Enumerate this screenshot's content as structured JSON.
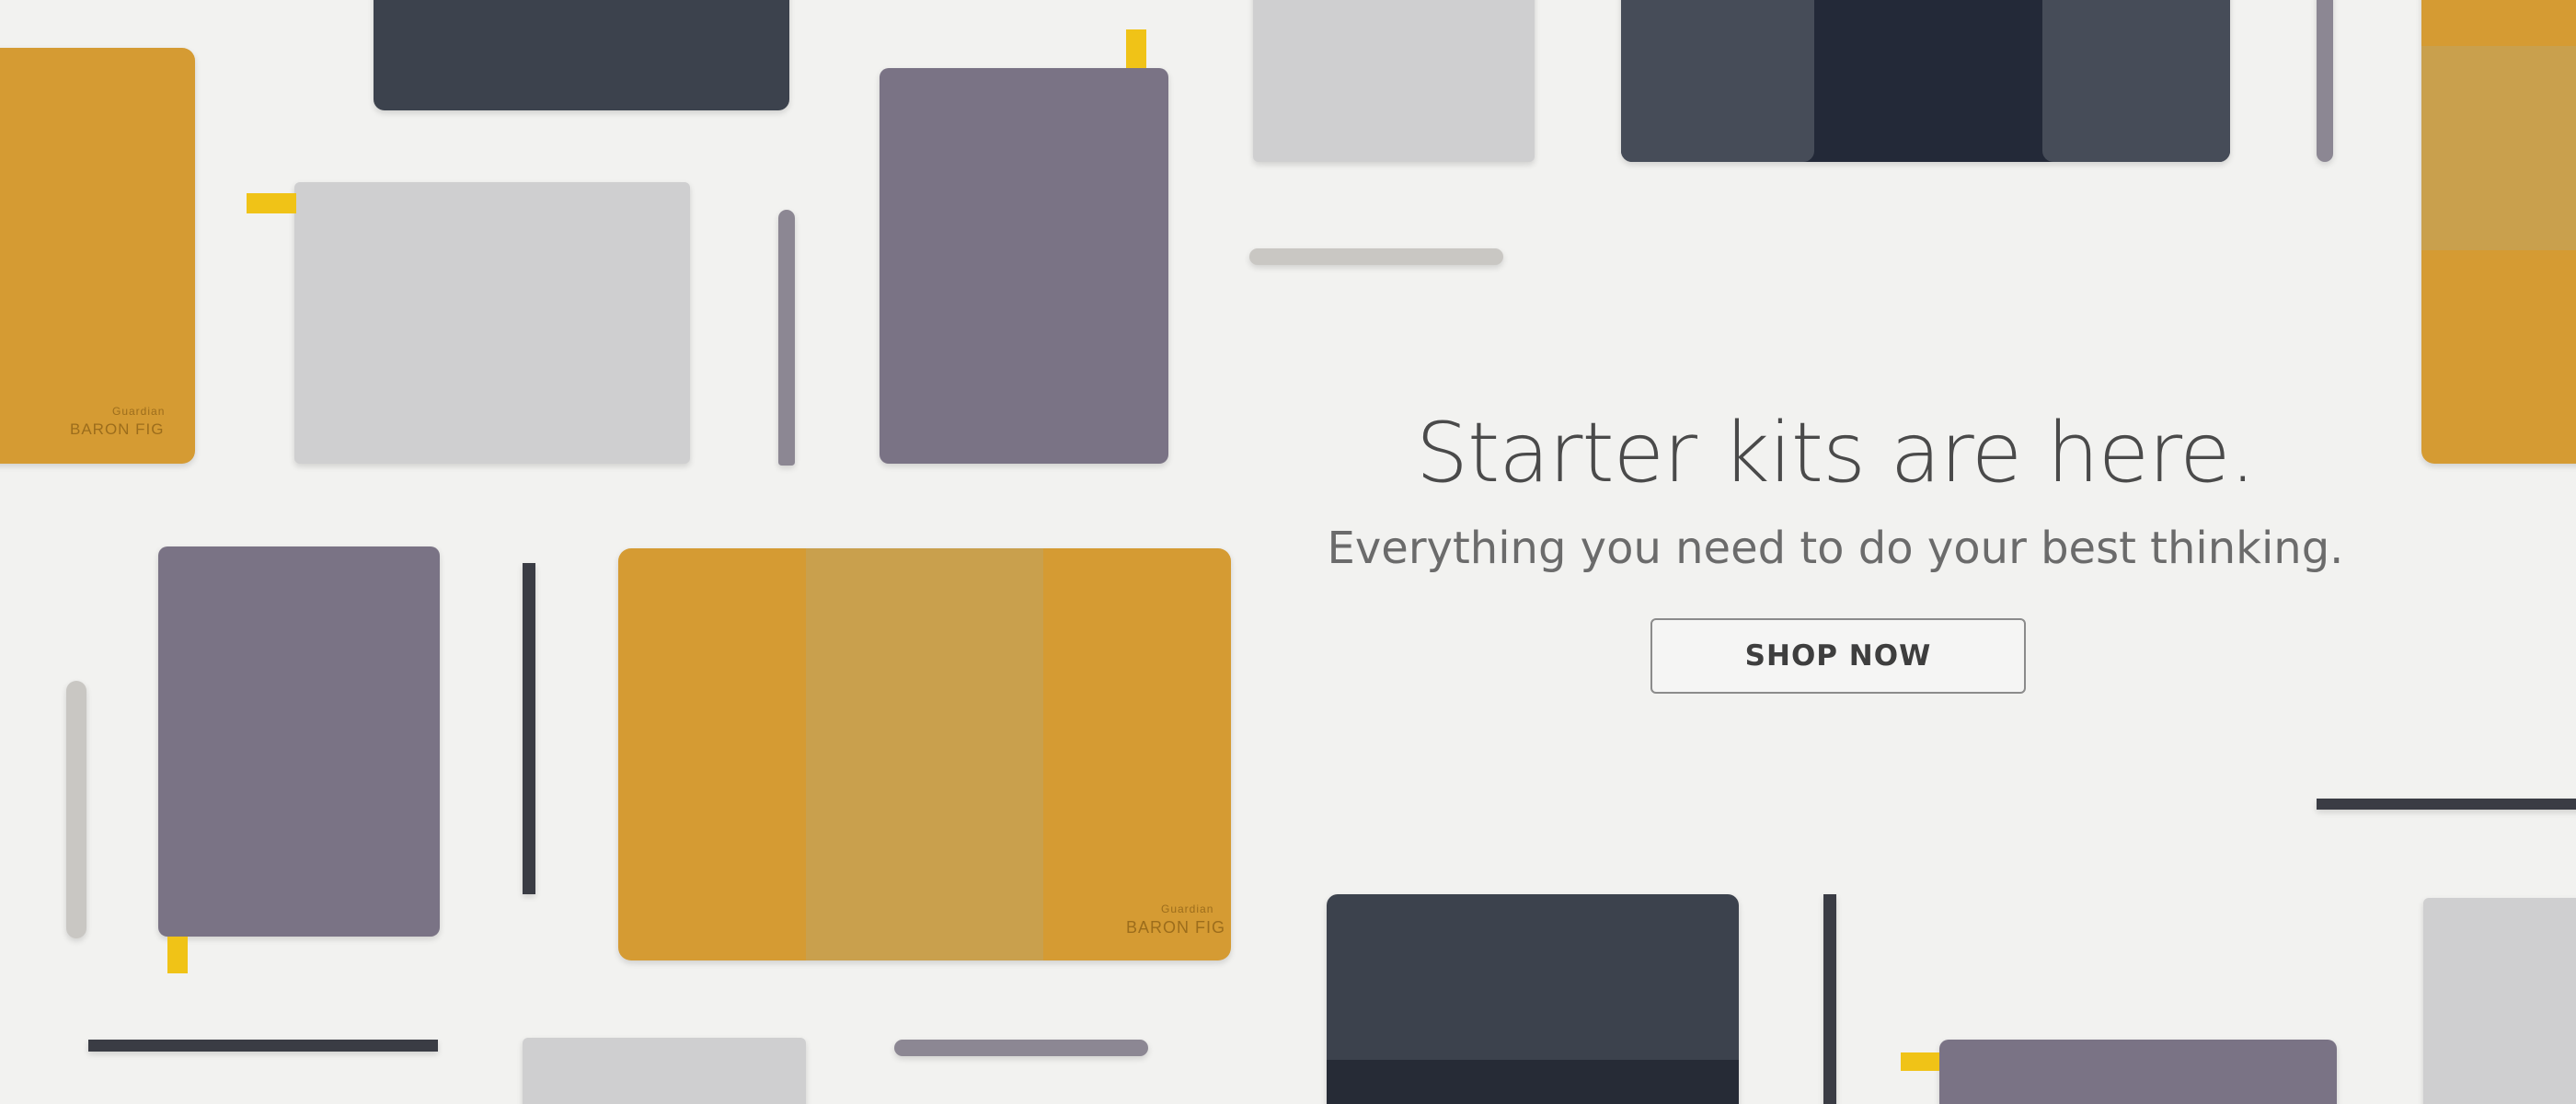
{
  "hero": {
    "headline": "Starter kits are here.",
    "subheadline": "Everything you need to do your best thinking.",
    "cta_label": "SHOP NOW"
  },
  "product_markings": {
    "leather_brand": "BARON FIG",
    "leather_model": "Guardian"
  },
  "colors": {
    "background": "#f2f2f0",
    "leather": "#d59b33",
    "notebook_purple": "#7a7385",
    "notebook_light": "#cfcfd0",
    "notebook_dark": "#3c424d",
    "ribbon_yellow": "#f0c317",
    "text_dark": "#4a4a4a"
  }
}
